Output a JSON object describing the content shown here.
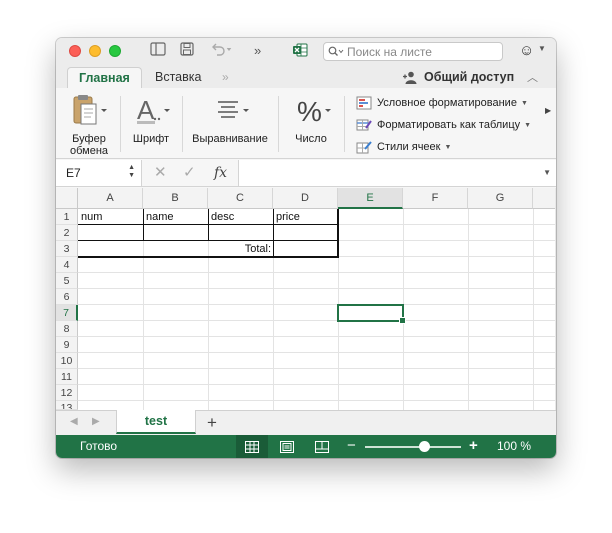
{
  "search": {
    "placeholder": "Поиск на листе"
  },
  "ribbon": {
    "tabs": {
      "home": "Главная",
      "insert": "Вставка"
    },
    "share": "Общий доступ",
    "groups": {
      "clipboard_line1": "Буфер",
      "clipboard_line2": "обмена",
      "font": "Шрифт",
      "alignment": "Выравнивание",
      "number": "Число"
    },
    "styles": {
      "conditional": "Условное форматирование",
      "format_table": "Форматировать как таблицу",
      "cell_styles": "Стили ячеек"
    }
  },
  "formula_bar": {
    "name_box": "E7",
    "formula": ""
  },
  "grid": {
    "columns": [
      "A",
      "B",
      "C",
      "D",
      "E",
      "F",
      "G"
    ],
    "rows": [
      "1",
      "2",
      "3",
      "4",
      "5",
      "6",
      "7",
      "8",
      "9",
      "10",
      "11",
      "12",
      "13"
    ],
    "selected_cell": "E7",
    "cells": {
      "a1": "num",
      "b1": "name",
      "c1": "desc",
      "d1": "price",
      "c3": "Total:"
    }
  },
  "sheets": {
    "active": "test"
  },
  "status": {
    "ready": "Готово",
    "zoom": "100 %",
    "zoom_level_percent": 100
  },
  "colors": {
    "accent": "#217346"
  }
}
